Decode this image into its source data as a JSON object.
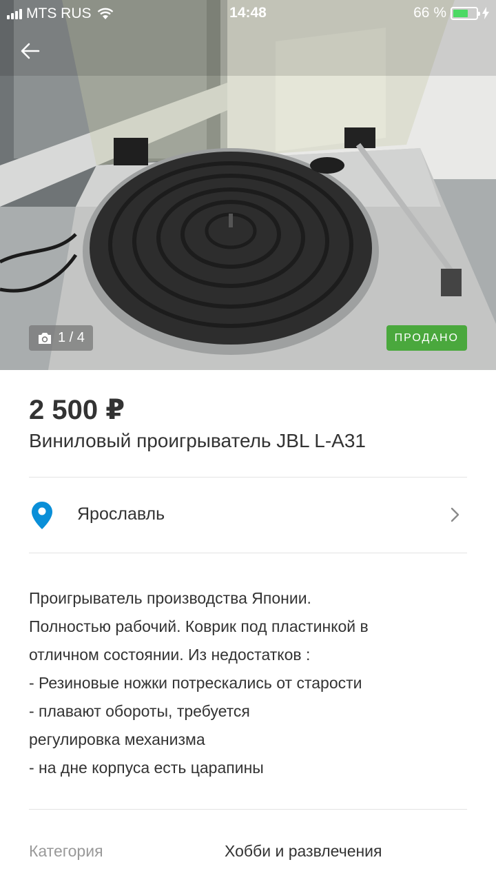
{
  "status_bar": {
    "carrier": "MTS RUS",
    "time": "14:48",
    "battery_percent": "66 %",
    "battery_level": 0.66
  },
  "gallery": {
    "counter": "1 / 4",
    "badge": "ПРОДАНО"
  },
  "listing": {
    "price": "2 500 ₽",
    "title": "Виниловый проигрыватель JBL L-A31",
    "location": "Ярославль",
    "description_lines": [
      "Проигрыватель производства Японии.",
      "Полностью рабочий. Коврик под пластинкой в",
      "отличном состоянии. Из недостатков :",
      "- Резиновые ножки потрескались от старости",
      "- плавают обороты, требуется",
      "регулировка механизма",
      "- на дне корпуса есть царапины"
    ]
  },
  "params": [
    {
      "label": "Категория",
      "value": "Хобби и развлечения"
    }
  ],
  "colors": {
    "sold_badge": "#4aa83d",
    "pin": "#0a8fd8",
    "battery": "#4cd964"
  },
  "icons": {
    "back": "arrow-left-icon",
    "camera": "camera-icon",
    "pin": "location-pin-icon",
    "chevron": "chevron-right-icon"
  }
}
